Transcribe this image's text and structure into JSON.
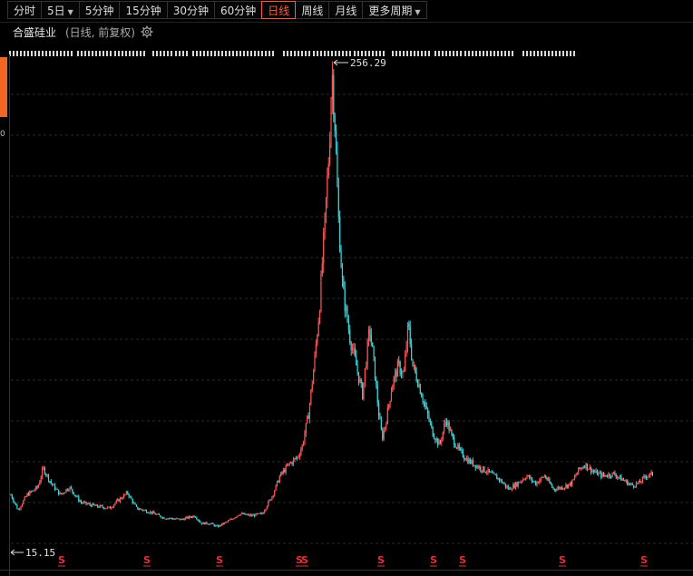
{
  "toolbar": {
    "tabs": [
      {
        "label": "分时",
        "dropdown": false,
        "active": false
      },
      {
        "label": "5日",
        "dropdown": true,
        "active": false
      },
      {
        "label": "5分钟",
        "dropdown": false,
        "active": false
      },
      {
        "label": "15分钟",
        "dropdown": false,
        "active": false
      },
      {
        "label": "30分钟",
        "dropdown": false,
        "active": false
      },
      {
        "label": "60分钟",
        "dropdown": false,
        "active": false
      },
      {
        "label": "日线",
        "dropdown": false,
        "active": true
      },
      {
        "label": "周线",
        "dropdown": false,
        "active": false
      },
      {
        "label": "月线",
        "dropdown": false,
        "active": false
      },
      {
        "label": "更多周期",
        "dropdown": true,
        "active": false
      }
    ]
  },
  "chart_header": {
    "stock_name": "合盛硅业",
    "period_info": "(日线, 前复权)"
  },
  "colors": {
    "up": "#ff5555",
    "down": "#3fd4d8",
    "active_tab": "#ff5a3c",
    "background": "#000000",
    "grid": "#2a2a2a",
    "accent": "#f26522",
    "marker": "#e83030"
  },
  "icons": {
    "settings": "gear-icon",
    "dropdown": "caret-down-icon",
    "event_marker": "s-marker-icon"
  },
  "chart_data": {
    "type": "candlestick",
    "title": "合盛硅业",
    "subtitle": "(日线, 前复权)",
    "ylim": [
      5,
      260
    ],
    "grid": "horizontal-dashed",
    "annotations": [
      {
        "label": "256.29",
        "value": 256.29,
        "kind": "max"
      },
      {
        "label": "15.15",
        "value": 15.15,
        "kind": "min"
      }
    ],
    "path": [
      [
        0,
        32
      ],
      [
        8,
        24
      ],
      [
        18,
        32
      ],
      [
        30,
        36
      ],
      [
        36,
        46
      ],
      [
        45,
        38
      ],
      [
        55,
        32
      ],
      [
        65,
        36
      ],
      [
        78,
        28
      ],
      [
        95,
        26
      ],
      [
        110,
        25
      ],
      [
        122,
        30
      ],
      [
        130,
        33
      ],
      [
        140,
        25
      ],
      [
        155,
        23
      ],
      [
        170,
        20
      ],
      [
        190,
        19
      ],
      [
        205,
        21
      ],
      [
        212,
        17
      ],
      [
        222,
        17
      ],
      [
        230,
        15.15
      ],
      [
        242,
        18
      ],
      [
        255,
        22
      ],
      [
        268,
        21
      ],
      [
        280,
        22
      ],
      [
        292,
        32
      ],
      [
        300,
        42
      ],
      [
        310,
        48
      ],
      [
        320,
        52
      ],
      [
        325,
        58
      ],
      [
        332,
        75
      ],
      [
        338,
        100
      ],
      [
        344,
        130
      ],
      [
        350,
        175
      ],
      [
        355,
        215
      ],
      [
        358,
        256.29
      ],
      [
        361,
        230
      ],
      [
        365,
        180
      ],
      [
        370,
        140
      ],
      [
        378,
        115
      ],
      [
        385,
        100
      ],
      [
        392,
        85
      ],
      [
        400,
        120
      ],
      [
        405,
        100
      ],
      [
        410,
        75
      ],
      [
        414,
        62
      ],
      [
        418,
        70
      ],
      [
        425,
        90
      ],
      [
        432,
        100
      ],
      [
        438,
        95
      ],
      [
        443,
        122
      ],
      [
        448,
        100
      ],
      [
        455,
        90
      ],
      [
        462,
        78
      ],
      [
        470,
        65
      ],
      [
        478,
        58
      ],
      [
        485,
        72
      ],
      [
        492,
        62
      ],
      [
        500,
        55
      ],
      [
        510,
        50
      ],
      [
        520,
        47
      ],
      [
        532,
        44
      ],
      [
        545,
        40
      ],
      [
        555,
        35
      ],
      [
        565,
        38
      ],
      [
        575,
        42
      ],
      [
        585,
        38
      ],
      [
        595,
        42
      ],
      [
        605,
        35
      ],
      [
        615,
        36
      ],
      [
        625,
        38
      ],
      [
        633,
        45
      ],
      [
        640,
        48
      ],
      [
        650,
        44
      ],
      [
        660,
        42
      ],
      [
        672,
        43
      ],
      [
        682,
        40
      ],
      [
        692,
        37
      ],
      [
        700,
        38
      ],
      [
        708,
        42
      ],
      [
        716,
        43
      ]
    ],
    "markers": [
      {
        "label": "S",
        "x": 68
      },
      {
        "label": "S",
        "x": 162
      },
      {
        "label": "S",
        "x": 242
      },
      {
        "label": "S",
        "x": 330
      },
      {
        "label": "S",
        "x": 336
      },
      {
        "label": "S",
        "x": 420
      },
      {
        "label": "S",
        "x": 478
      },
      {
        "label": "S",
        "x": 510
      },
      {
        "label": "S",
        "x": 620
      },
      {
        "label": "S",
        "x": 710
      }
    ]
  }
}
